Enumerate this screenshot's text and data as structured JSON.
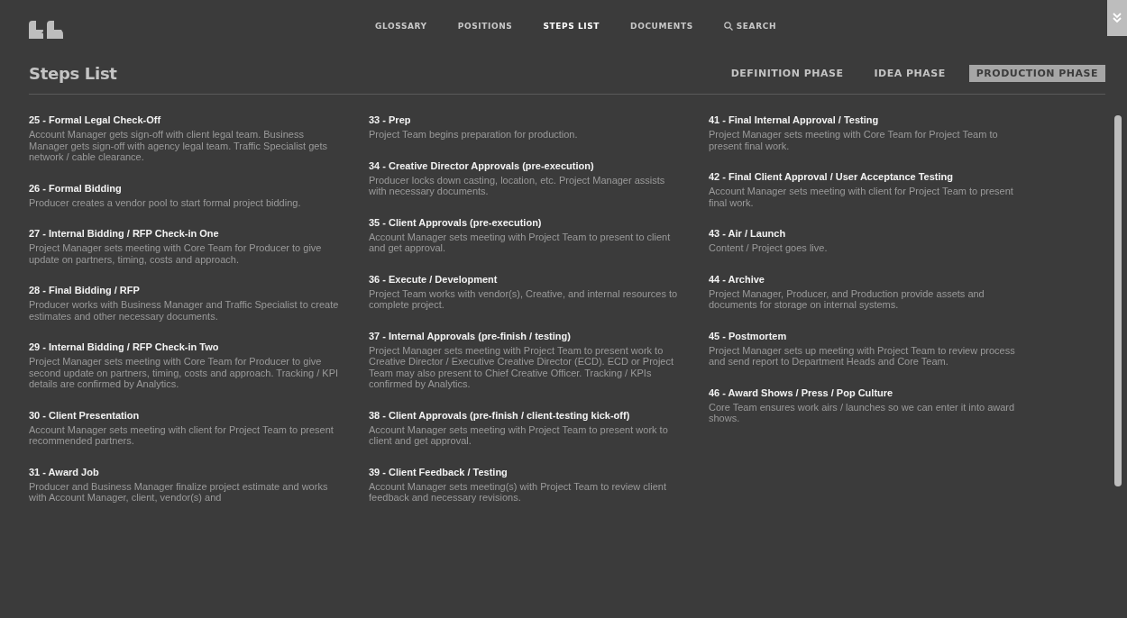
{
  "nav": {
    "items": [
      {
        "label": "GLOSSARY",
        "selected": false,
        "kind": "link"
      },
      {
        "label": "POSITIONS",
        "selected": false,
        "kind": "link"
      },
      {
        "label": "STEPS LIST",
        "selected": true,
        "kind": "link"
      },
      {
        "label": "DOCUMENTS",
        "selected": false,
        "kind": "link"
      },
      {
        "label": "SEARCH",
        "selected": false,
        "kind": "search"
      }
    ]
  },
  "page_title": "Steps List",
  "phase_tabs": [
    {
      "label": "DEFINITION PHASE",
      "selected": false
    },
    {
      "label": "IDEA PHASE",
      "selected": false
    },
    {
      "label": "PRODUCTION PHASE",
      "selected": true
    }
  ],
  "columns": [
    {
      "steps": [
        {
          "title": "25 - Formal Legal Check-Off",
          "description": "Account Manager gets sign-off with client legal team. Business Manager gets sign-off with agency legal team. Traffic Specialist gets network / cable clearance."
        },
        {
          "title": "26 - Formal Bidding",
          "description": "Producer creates a vendor pool to start formal project bidding."
        },
        {
          "title": "27 - Internal Bidding / RFP Check-in One",
          "description": "Project Manager sets meeting with Core Team for Producer to give update on partners, timing, costs and approach."
        },
        {
          "title": "28 - Final Bidding / RFP",
          "description": "Producer works with Business Manager and Traffic Specialist to create estimates and other necessary documents."
        },
        {
          "title": "29 - Internal Bidding / RFP Check-in Two",
          "description": "Project Manager sets meeting with Core Team for Producer to give second update on partners, timing, costs and approach. Tracking / KPI details are confirmed by Analytics."
        },
        {
          "title": "30 - Client Presentation",
          "description": "Account Manager sets meeting with client for Project Team to present recommended partners."
        },
        {
          "title": "31 - Award Job",
          "description": "Producer and Business Manager finalize project estimate and works with Account Manager, client, vendor(s) and"
        }
      ]
    },
    {
      "steps": [
        {
          "title": "33 - Prep",
          "description": "Project Team begins preparation for production."
        },
        {
          "title": "34 - Creative Director Approvals (pre-execution)",
          "description": "Producer locks down casting, location, etc. Project Manager assists with necessary documents."
        },
        {
          "title": "35 - Client Approvals (pre-execution)",
          "description": "Account Manager sets meeting with Project Team to present to client and get approval."
        },
        {
          "title": "36 - Execute / Development",
          "description": "Project Team works with vendor(s), Creative, and internal resources to complete project."
        },
        {
          "title": "37 - Internal Approvals (pre-finish / testing)",
          "description": "Project Manager sets meeting with Project Team to present work to Creative Director / Executive Creative Director (ECD). ECD or Project Team may also present to Chief Creative Officer. Tracking / KPIs confirmed by Analytics."
        },
        {
          "title": "38 - Client Approvals (pre-finish / client-testing kick-off)",
          "description": "Account Manager sets meeting with Project Team to present work to client and get approval."
        },
        {
          "title": "39 - Client Feedback / Testing",
          "description": "Account Manager sets meeting(s) with Project Team to review client feedback and necessary revisions."
        }
      ]
    },
    {
      "steps": [
        {
          "title": "41 - Final Internal Approval / Testing",
          "description": "Project Manager sets meeting with Core Team for Project Team to present final work."
        },
        {
          "title": "42 - Final Client Approval / User Acceptance Testing",
          "description": "Account Manager sets meeting with client for Project Team to present final work."
        },
        {
          "title": "43 - Air / Launch",
          "description": "Content / Project goes live."
        },
        {
          "title": "44 - Archive",
          "description": "Project Manager, Producer, and Production provide assets and documents for storage on internal systems."
        },
        {
          "title": "45 - Postmortem",
          "description": "Project Manager sets up meeting with Project Team to review process and send report to Department Heads and Core Team."
        },
        {
          "title": "46 - Award Shows / Press / Pop Culture",
          "description": "Core Team ensures work airs / launches so we can enter it into award shows."
        }
      ]
    }
  ]
}
